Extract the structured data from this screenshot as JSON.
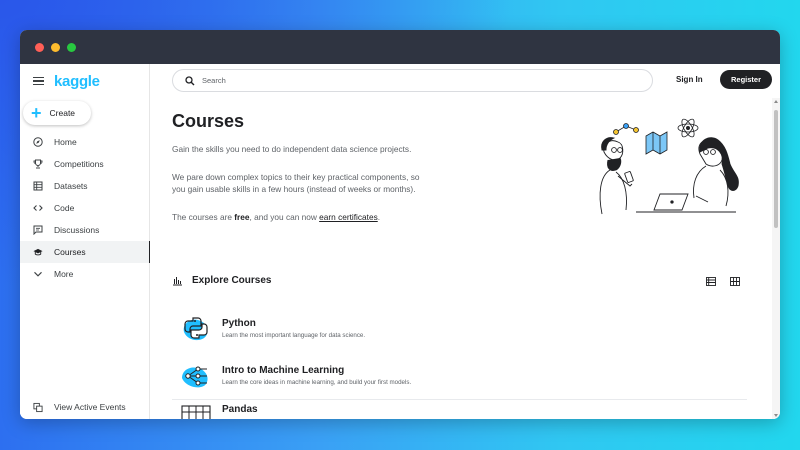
{
  "window": {
    "dots": [
      "close",
      "minimize",
      "maximize"
    ]
  },
  "sidebar": {
    "logo": "kaggle",
    "create_label": "Create",
    "items": [
      {
        "label": "Home",
        "icon": "compass-icon"
      },
      {
        "label": "Competitions",
        "icon": "trophy-icon"
      },
      {
        "label": "Datasets",
        "icon": "table-icon"
      },
      {
        "label": "Code",
        "icon": "code-icon"
      },
      {
        "label": "Discussions",
        "icon": "comments-icon"
      },
      {
        "label": "Courses",
        "icon": "graduation-cap-icon",
        "active": true
      },
      {
        "label": "More",
        "icon": "chevron-down-icon"
      }
    ],
    "bottom_item": {
      "label": "View Active Events",
      "icon": "events-icon"
    }
  },
  "header": {
    "search_placeholder": "Search",
    "signin_label": "Sign In",
    "register_label": "Register"
  },
  "main": {
    "title": "Courses",
    "p1": "Gain the skills you need to do independent data science projects.",
    "p2": "We pare down complex topics to their key practical components, so you gain usable skills in a few hours (instead of weeks or months).",
    "p3_a": "The courses are ",
    "p3_free": "free",
    "p3_b": ", and you can now ",
    "p3_link": "earn certificates",
    "p3_c": ".",
    "explore_title": "Explore Courses",
    "courses": [
      {
        "title": "Python",
        "desc": "Learn the most important language for data science."
      },
      {
        "title": "Intro to Machine Learning",
        "desc": "Learn the core ideas in machine learning, and build your first models."
      },
      {
        "title": "Pandas",
        "desc": ""
      }
    ]
  },
  "colors": {
    "brand": "#20beff",
    "dark": "#202124",
    "text_secondary": "#5f6368"
  }
}
